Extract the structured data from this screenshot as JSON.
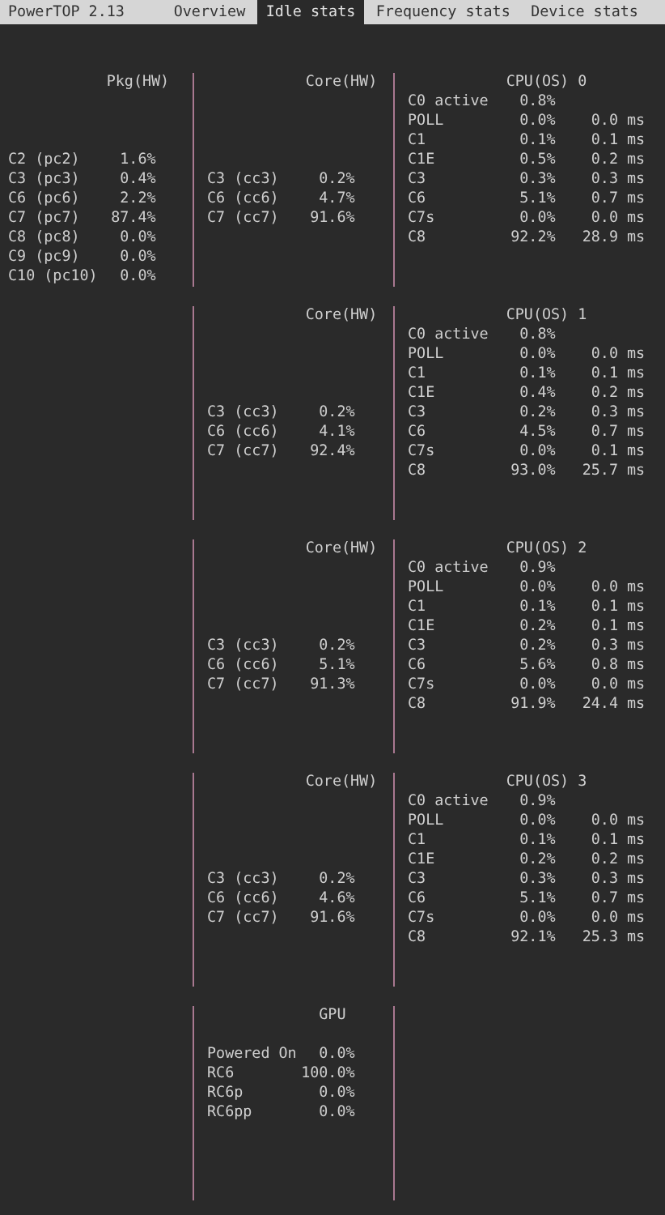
{
  "app_title": "PowerTOP 2.13",
  "tabs": [
    {
      "label": "Overview",
      "selected": false
    },
    {
      "label": "Idle stats",
      "selected": true
    },
    {
      "label": "Frequency stats",
      "selected": false
    },
    {
      "label": "Device stats",
      "selected": false
    }
  ],
  "package": {
    "title": "Pkg(HW)",
    "states": [
      {
        "name": "C2 (pc2)",
        "value": "1.6%"
      },
      {
        "name": "C3 (pc3)",
        "value": "0.4%"
      },
      {
        "name": "C6 (pc6)",
        "value": "2.2%"
      },
      {
        "name": "C7 (pc7)",
        "value": "87.4%"
      },
      {
        "name": "C8 (pc8)",
        "value": "0.0%"
      },
      {
        "name": "C9 (pc9)",
        "value": "0.0%"
      },
      {
        "name": "C10 (pc10)",
        "value": "0.0%"
      }
    ]
  },
  "cores": [
    {
      "title": "Core(HW)",
      "states": [
        {
          "name": "C3 (cc3)",
          "value": "0.2%"
        },
        {
          "name": "C6 (cc6)",
          "value": "4.7%"
        },
        {
          "name": "C7 (cc7)",
          "value": "91.6%"
        }
      ]
    },
    {
      "title": "Core(HW)",
      "states": [
        {
          "name": "C3 (cc3)",
          "value": "0.2%"
        },
        {
          "name": "C6 (cc6)",
          "value": "4.1%"
        },
        {
          "name": "C7 (cc7)",
          "value": "92.4%"
        }
      ]
    },
    {
      "title": "Core(HW)",
      "states": [
        {
          "name": "C3 (cc3)",
          "value": "0.2%"
        },
        {
          "name": "C6 (cc6)",
          "value": "5.1%"
        },
        {
          "name": "C7 (cc7)",
          "value": "91.3%"
        }
      ]
    },
    {
      "title": "Core(HW)",
      "states": [
        {
          "name": "C3 (cc3)",
          "value": "0.2%"
        },
        {
          "name": "C6 (cc6)",
          "value": "4.6%"
        },
        {
          "name": "C7 (cc7)",
          "value": "91.6%"
        }
      ]
    }
  ],
  "cpus": [
    {
      "title": "CPU(OS) 0",
      "states": [
        {
          "name": "C0 active",
          "value": "0.8%"
        },
        {
          "name": "POLL",
          "value": "0.0%",
          "time": "0.0 ms"
        },
        {
          "name": "C1",
          "value": "0.1%",
          "time": "0.1 ms"
        },
        {
          "name": "C1E",
          "value": "0.5%",
          "time": "0.2 ms"
        },
        {
          "name": "C3",
          "value": "0.3%",
          "time": "0.3 ms"
        },
        {
          "name": "C6",
          "value": "5.1%",
          "time": "0.7 ms"
        },
        {
          "name": "C7s",
          "value": "0.0%",
          "time": "0.0 ms"
        },
        {
          "name": "C8",
          "value": "92.2%",
          "time": "28.9 ms"
        }
      ]
    },
    {
      "title": "CPU(OS) 1",
      "states": [
        {
          "name": "C0 active",
          "value": "0.8%"
        },
        {
          "name": "POLL",
          "value": "0.0%",
          "time": "0.0 ms"
        },
        {
          "name": "C1",
          "value": "0.1%",
          "time": "0.1 ms"
        },
        {
          "name": "C1E",
          "value": "0.4%",
          "time": "0.2 ms"
        },
        {
          "name": "C3",
          "value": "0.2%",
          "time": "0.3 ms"
        },
        {
          "name": "C6",
          "value": "4.5%",
          "time": "0.7 ms"
        },
        {
          "name": "C7s",
          "value": "0.0%",
          "time": "0.1 ms"
        },
        {
          "name": "C8",
          "value": "93.0%",
          "time": "25.7 ms"
        }
      ]
    },
    {
      "title": "CPU(OS) 2",
      "states": [
        {
          "name": "C0 active",
          "value": "0.9%"
        },
        {
          "name": "POLL",
          "value": "0.0%",
          "time": "0.0 ms"
        },
        {
          "name": "C1",
          "value": "0.1%",
          "time": "0.1 ms"
        },
        {
          "name": "C1E",
          "value": "0.2%",
          "time": "0.1 ms"
        },
        {
          "name": "C3",
          "value": "0.2%",
          "time": "0.3 ms"
        },
        {
          "name": "C6",
          "value": "5.6%",
          "time": "0.8 ms"
        },
        {
          "name": "C7s",
          "value": "0.0%",
          "time": "0.0 ms"
        },
        {
          "name": "C8",
          "value": "91.9%",
          "time": "24.4 ms"
        }
      ]
    },
    {
      "title": "CPU(OS) 3",
      "states": [
        {
          "name": "C0 active",
          "value": "0.9%"
        },
        {
          "name": "POLL",
          "value": "0.0%",
          "time": "0.0 ms"
        },
        {
          "name": "C1",
          "value": "0.1%",
          "time": "0.1 ms"
        },
        {
          "name": "C1E",
          "value": "0.2%",
          "time": "0.2 ms"
        },
        {
          "name": "C3",
          "value": "0.3%",
          "time": "0.3 ms"
        },
        {
          "name": "C6",
          "value": "5.1%",
          "time": "0.7 ms"
        },
        {
          "name": "C7s",
          "value": "0.0%",
          "time": "0.0 ms"
        },
        {
          "name": "C8",
          "value": "92.1%",
          "time": "25.3 ms"
        }
      ]
    }
  ],
  "gpu": {
    "title": "GPU",
    "states": [
      {
        "name": "Powered On",
        "value": "0.0%"
      },
      {
        "name": "RC6",
        "value": "100.0%"
      },
      {
        "name": "RC6p",
        "value": "0.0%"
      },
      {
        "name": "RC6pp",
        "value": "0.0%"
      }
    ]
  }
}
